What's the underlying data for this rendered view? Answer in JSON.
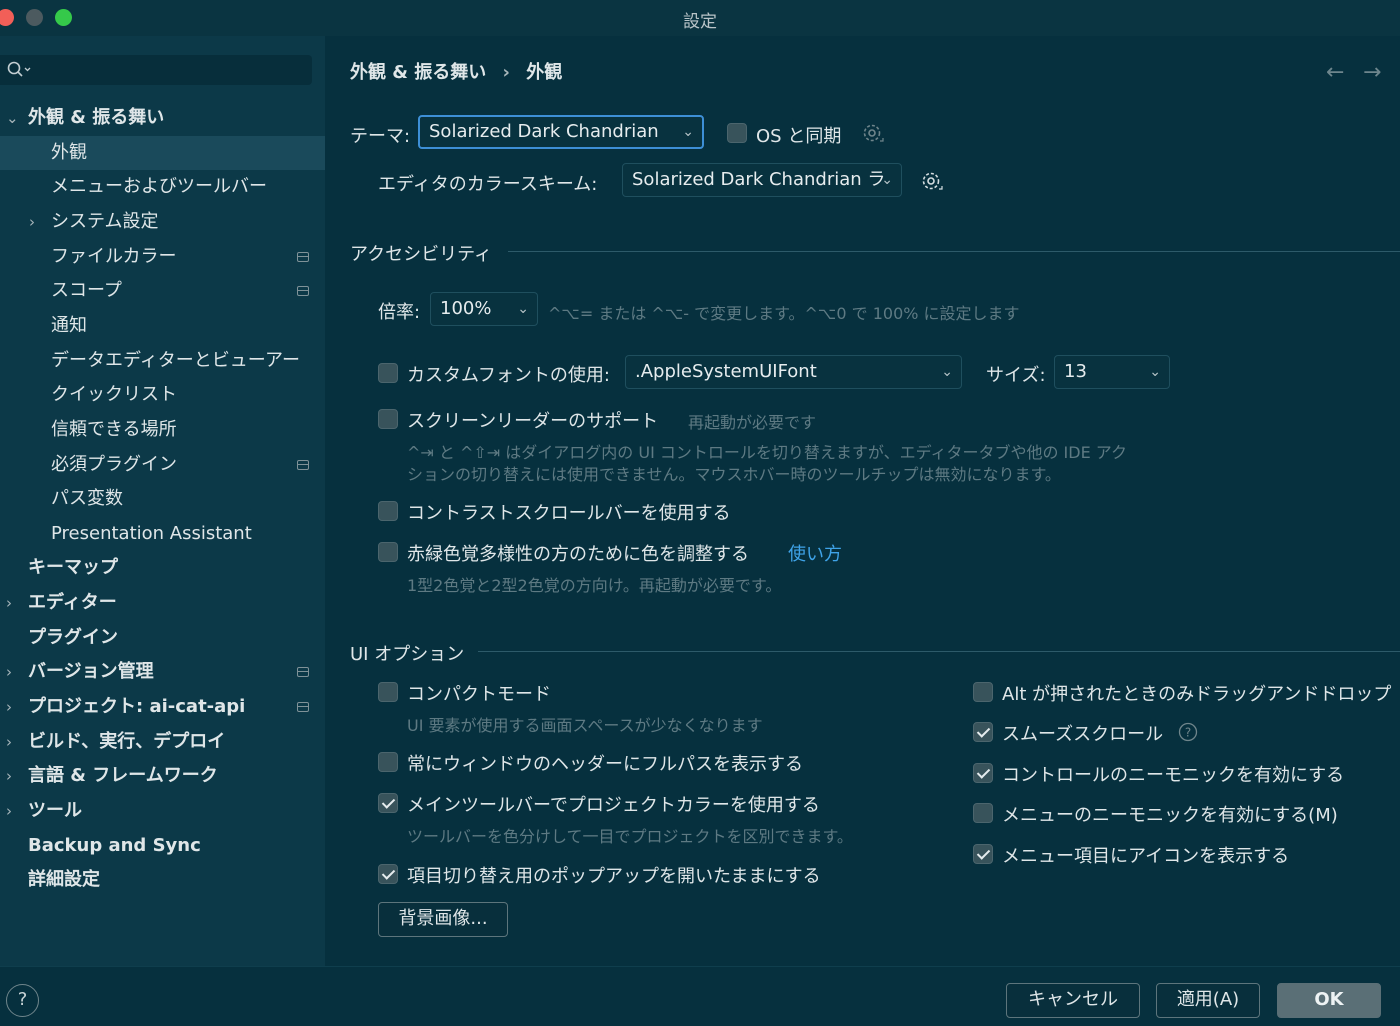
{
  "window": {
    "title": "設定"
  },
  "search": {
    "placeholder": ""
  },
  "sidebar": {
    "items": [
      {
        "label": "外観 & 振る舞い",
        "chevron": "down"
      },
      {
        "label": "外観"
      },
      {
        "label": "メニューおよびツールバー"
      },
      {
        "label": "システム設定",
        "chevron": "right"
      },
      {
        "label": "ファイルカラー"
      },
      {
        "label": "スコープ"
      },
      {
        "label": "通知"
      },
      {
        "label": "データエディターとビューアー"
      },
      {
        "label": "クイックリスト"
      },
      {
        "label": "信頼できる場所"
      },
      {
        "label": "必須プラグイン"
      },
      {
        "label": "パス変数"
      },
      {
        "label": "Presentation Assistant"
      },
      {
        "label": "キーマップ"
      },
      {
        "label": "エディター",
        "chevron": "right"
      },
      {
        "label": "プラグイン"
      },
      {
        "label": "バージョン管理",
        "chevron": "right"
      },
      {
        "label": "プロジェクト: ai-cat-api",
        "chevron": "right"
      },
      {
        "label": "ビルド、実行、デプロイ",
        "chevron": "right"
      },
      {
        "label": "言語 & フレームワーク",
        "chevron": "right"
      },
      {
        "label": "ツール",
        "chevron": "right"
      },
      {
        "label": "Backup and Sync"
      },
      {
        "label": "詳細設定"
      }
    ]
  },
  "breadcrumb": {
    "parent": "外観 & 振る舞い",
    "separator": "›",
    "current": "外観"
  },
  "nav": {
    "back": "←",
    "forward": "→"
  },
  "theme": {
    "label": "テーマ:",
    "value": "Solarized Dark Chandrian",
    "sync_label": "OS と同期",
    "scheme_label": "エディタのカラースキーム:",
    "scheme_value": "Solarized Dark Chandrian ラ"
  },
  "accessibility": {
    "section": "アクセシビリティ",
    "zoom_label": "倍率:",
    "zoom_value": "100%",
    "zoom_hint": "^⌥= または ^⌥- で変更します。^⌥0 で 100% に設定します",
    "custom_font_label": "カスタムフォントの使用:",
    "font_value": ".AppleSystemUIFont",
    "size_label": "サイズ:",
    "size_value": "13",
    "screen_reader_label": "スクリーンリーダーのサポート",
    "screen_reader_note": "再起動が必要です",
    "screen_reader_hint_1": "^⇥ と ^⇧⇥ はダイアログ内の UI コントロールを切り替えますが、エディタータブや他の IDE アク",
    "screen_reader_hint_2": "ションの切り替えには使用できません。マウスホバー時のツールチップは無効になります。",
    "contrast_label": "コントラストスクロールバーを使用する",
    "color_adjust_label": "赤緑色覚多様性の方のために色を調整する",
    "color_adjust_link": "使い方",
    "color_adjust_hint": "1型2色覚と2型2色覚の方向け。再起動が必要です。"
  },
  "ui_options": {
    "section": "UI オプション",
    "compact_label": "コンパクトモード",
    "compact_hint": "UI 要素が使用する画面スペースが少なくなります",
    "fullpath_label": "常にウィンドウのヘッダーにフルパスを表示する",
    "project_color_label": "メインツールバーでプロジェクトカラーを使用する",
    "project_color_hint": "ツールバーを色分けして一目でプロジェクトを区別できます。",
    "popup_label": "項目切り替え用のポップアップを開いたままにする",
    "bg_image_button": "背景画像...",
    "alt_drag_label": "Alt が押されたときのみドラッグアンドドロップ",
    "smooth_scroll_label": "スムーズスクロール",
    "mnemonic_controls_label": "コントロールのニーモニックを有効にする",
    "mnemonic_menu_label": "メニューのニーモニックを有効にする(M)",
    "menu_icons_label": "メニュー項目にアイコンを表示する"
  },
  "footer": {
    "help": "?",
    "cancel": "キャンセル",
    "apply": "適用(A)",
    "ok": "OK"
  },
  "colors": {
    "background": "#06303e",
    "sidebar": "#0c3948",
    "selection": "#1a4a5b",
    "accent_link": "#3fa3e8",
    "focus_border": "#3d8fd6"
  }
}
